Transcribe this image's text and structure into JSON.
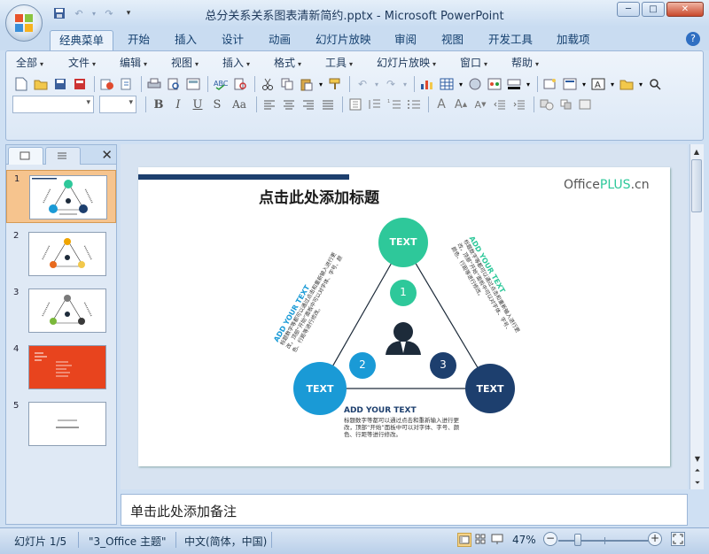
{
  "window": {
    "title": "总分关系关系图表清新简约.pptx - Microsoft PowerPoint",
    "min_label": "─",
    "max_label": "□",
    "close_label": "✕"
  },
  "ribbon_tabs": [
    "经典菜单",
    "开始",
    "插入",
    "设计",
    "动画",
    "幻灯片放映",
    "审阅",
    "视图",
    "开发工具",
    "加载项"
  ],
  "help_label": "?",
  "classic_menu": [
    "全部",
    "文件",
    "编辑",
    "视图",
    "插入",
    "格式",
    "工具",
    "幻灯片放映",
    "窗口",
    "帮助"
  ],
  "format_buttons": [
    "B",
    "I",
    "U",
    "S",
    "Aa"
  ],
  "left_pane": {
    "close_label": "✕",
    "slides": [
      {
        "num": "1",
        "selected": true
      },
      {
        "num": "2",
        "selected": false
      },
      {
        "num": "3",
        "selected": false
      },
      {
        "num": "4",
        "selected": false
      },
      {
        "num": "5",
        "selected": false
      }
    ]
  },
  "slide": {
    "title": "点击此处添加标题",
    "logo_prefix": "Office",
    "logo_plus": "PLUS",
    "logo_suffix": ".cn",
    "node_top": "TEXT",
    "node_left": "TEXT",
    "node_right": "TEXT",
    "num1": "1",
    "num2": "2",
    "num3": "3",
    "heading_left": "ADD YOUR TEXT",
    "body_left": "标题数字等都可以通过点击和重新输入进行更改，顶部“开始”面板中可以对字体、字号、颜色、行距等进行修改。",
    "heading_right": "ADD YOUR TEXT",
    "body_right": "标题数字等都可以通过点击和重新输入进行更改，顶部“开始”面板中可以对字体、字号、颜色、行距等进行修改。",
    "heading_bottom": "ADD YOUR TEXT",
    "body_bottom_1": "标题数字等都可以通过点击和重新输入进行更",
    "body_bottom_2": "改，顶部“开始”面板中可以对字体、字号、颜",
    "body_bottom_3": "色、行距等进行修改。",
    "colors": {
      "green": "#2ec89a",
      "blue": "#1a9ad6",
      "navy": "#1d3f6e",
      "dark": "#1d2b3a"
    }
  },
  "notes": {
    "placeholder": "单击此处添加备注"
  },
  "status": {
    "slide_info": "幻灯片 1/5",
    "theme": "\"3_Office 主题\"",
    "language": "中文(简体，中国)",
    "zoom": "47%",
    "zoom_out": "−",
    "zoom_in": "+"
  }
}
